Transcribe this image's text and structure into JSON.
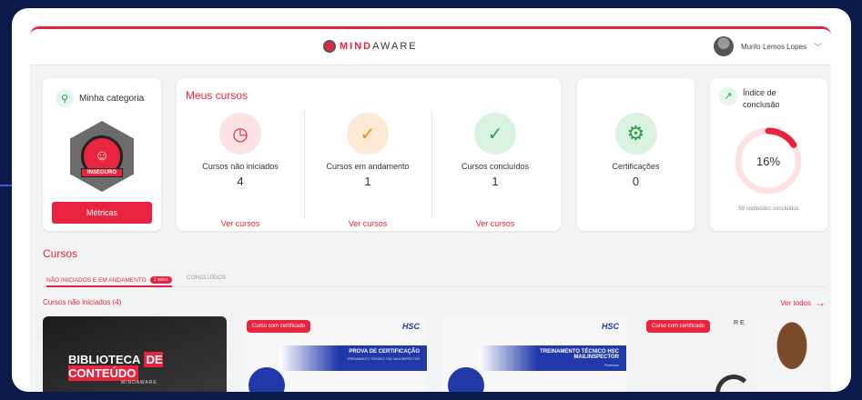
{
  "header": {
    "logo_text_bold": "MIND",
    "logo_text_rest": "AWARE",
    "user_name": "Murilo Lemos Lopes"
  },
  "category": {
    "title": "Minha categoria",
    "badge_label": "INSEGURO",
    "button": "Métricas"
  },
  "my_courses": {
    "title": "Meus cursos",
    "items": [
      {
        "label": "Cursos não iniciados",
        "count": "4",
        "link": "Ver cursos",
        "icon": "clock-icon",
        "color": "#fde2e4",
        "icon_color": "#e8243f"
      },
      {
        "label": "Cursos em andamento",
        "count": "1",
        "link": "Ver cursos",
        "icon": "progress-check-icon",
        "color": "#fde9d6",
        "icon_color": "#f08c00"
      },
      {
        "label": "Cursos concluídos",
        "count": "1",
        "link": "Ver cursos",
        "icon": "check-circle-icon",
        "color": "#d9f2e1",
        "icon_color": "#2f9e44"
      }
    ]
  },
  "certificates": {
    "label": "Certificações",
    "count": "0"
  },
  "completion": {
    "title_line1": "Índice de",
    "title_line2": "conclusão",
    "percent": 16,
    "percent_text": "16%",
    "footer": "59 conteúdos concluídos"
  },
  "courses_section": {
    "title": "Cursos",
    "tab_active": "NÃO INICIADOS E EM ANDAMENTO",
    "tab_badge": "1 aviso",
    "tab_other": "CONCLUÍDOS",
    "subtitle": "Cursos não iniciados (4)",
    "see_all": "Ver todos",
    "cards": [
      {
        "lib_a": "BIBLIOTECA",
        "lib_b": "DE CONTEÚDO",
        "lib_logo": "MINDAWARE"
      },
      {
        "tag": "Curso com certificado",
        "brand": "HSC",
        "line1": "PROVA DE CERTIFICAÇÃO",
        "line2": "TREINAMENTO TÉCNICO HSC MAILINSPECTOR"
      },
      {
        "brand": "HSC",
        "line1": "TREINAMENTO TÉCNICO HSC MAILINSPECTOR",
        "line2": "Revendas"
      },
      {
        "tag": "Curso com certificado",
        "partial": "R E"
      }
    ]
  },
  "colors": {
    "accent": "#e8243f",
    "bg": "#0b1a4a"
  }
}
